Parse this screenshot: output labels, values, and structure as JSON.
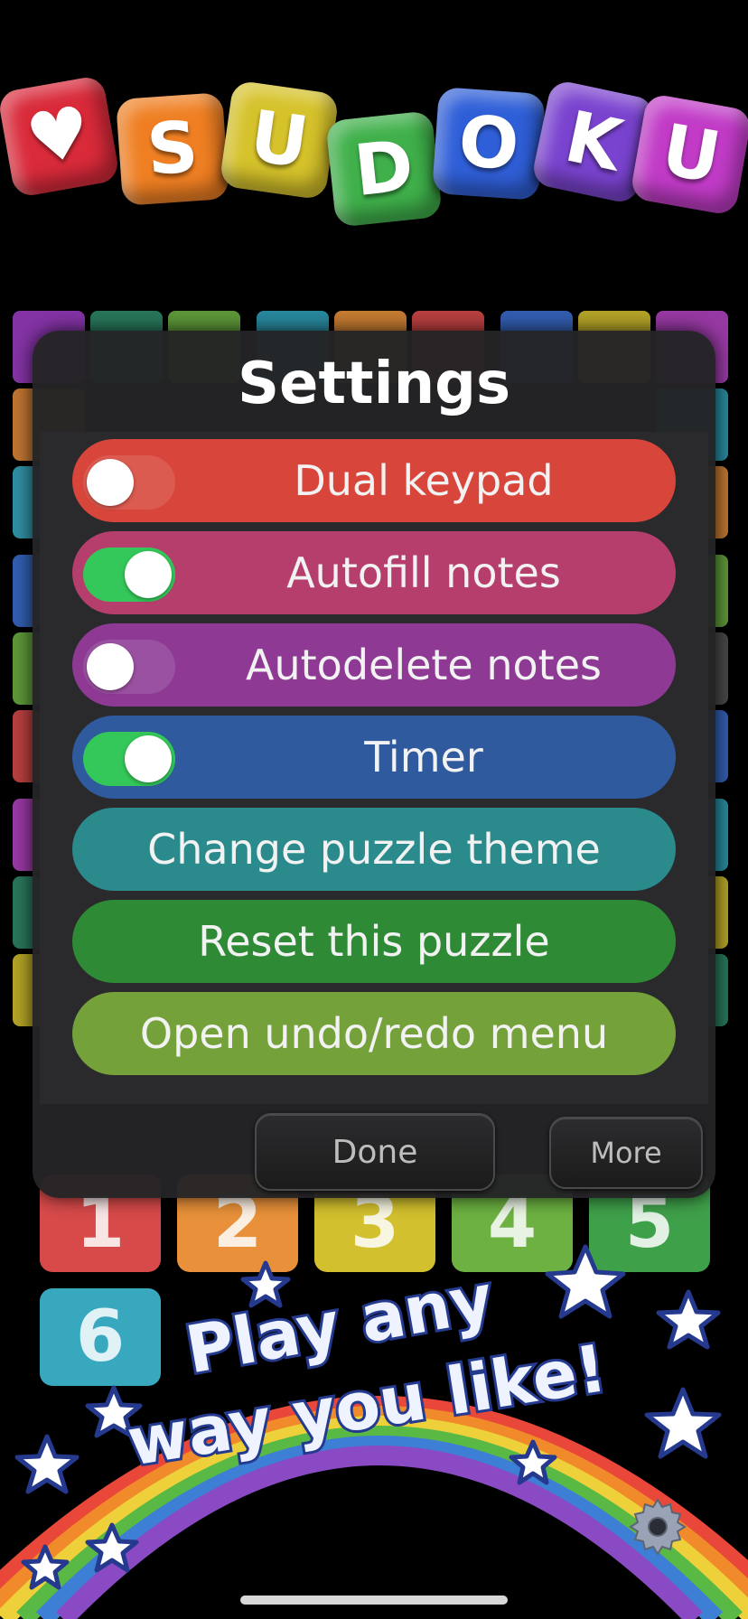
{
  "logo": {
    "letters": [
      "♥",
      "S",
      "U",
      "D",
      "O",
      "K",
      "U"
    ],
    "colors": [
      "#d92a3a",
      "#ef7f22",
      "#d6c22a",
      "#3fb04a",
      "#2f5fd8",
      "#7a43cf",
      "#c13bc7"
    ]
  },
  "keypad_keys": [
    "1",
    "2",
    "3",
    "4",
    "5",
    "6"
  ],
  "settings": {
    "title": "Settings",
    "toggles": [
      {
        "label": "Dual keypad",
        "on": false,
        "color": "#d8453a"
      },
      {
        "label": "Autofill notes",
        "on": true,
        "color": "#b53e6c"
      },
      {
        "label": "Autodelete notes",
        "on": false,
        "color": "#8e3a94"
      },
      {
        "label": "Timer",
        "on": true,
        "color": "#2f5a9e"
      }
    ],
    "actions": [
      {
        "label": "Change puzzle theme",
        "color": "#2a8a8c"
      },
      {
        "label": "Reset this puzzle",
        "color": "#2e8a35"
      },
      {
        "label": "Open undo/redo menu",
        "color": "#74a13a"
      }
    ],
    "done_label": "Done",
    "more_label": "More"
  },
  "promo": {
    "line1": "Play any",
    "line2": "way you like!"
  }
}
